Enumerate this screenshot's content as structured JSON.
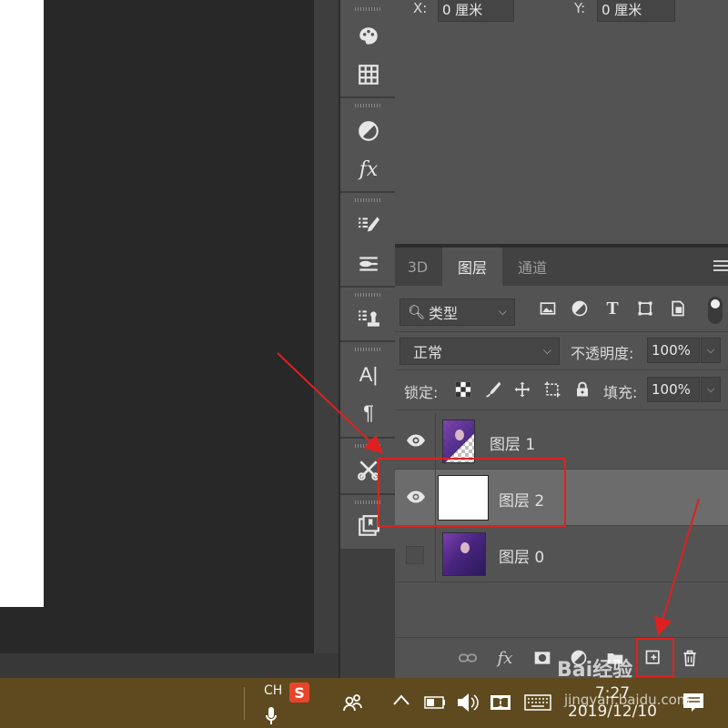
{
  "properties": {
    "x_label": "X:",
    "x_value": "0 厘米",
    "y_label": "Y:",
    "y_value": "0 厘米"
  },
  "layers_panel": {
    "tabs": [
      {
        "label": "3D",
        "active": false
      },
      {
        "label": "图层",
        "active": true
      },
      {
        "label": "通道",
        "active": false
      }
    ],
    "filter_type": "类型",
    "blend_mode": "正常",
    "opacity_label": "不透明度:",
    "opacity_value": "100%",
    "lock_label": "锁定:",
    "fill_label": "填充:",
    "fill_value": "100%",
    "layers": [
      {
        "name": "图层 1",
        "visible": true,
        "selected": false,
        "thumbnail": "transparent-photo"
      },
      {
        "name": "图层 2",
        "visible": true,
        "selected": true,
        "thumbnail": "white"
      },
      {
        "name": "图层 0",
        "visible": false,
        "selected": false,
        "thumbnail": "photo"
      }
    ],
    "footer_icons": [
      "link-icon",
      "fx-icon",
      "mask-icon",
      "adjustment-icon",
      "group-folder-icon",
      "new-layer-icon",
      "trash-icon"
    ],
    "footer_fx": "fx"
  },
  "toolstrip": {
    "icons": [
      "palette-icon",
      "grid-icon",
      "adjust-icon",
      "fx-style-icon",
      "brush-settings-icon",
      "brush-presets-icon",
      "clone-source-icon",
      "character-icon",
      "paragraph-icon",
      "tools-icon",
      "paths-icon"
    ],
    "character_text": "A|",
    "paragraph_text": "¶",
    "fx_text": "fx"
  },
  "taskbar": {
    "ime": "CH",
    "ime_logo": "S",
    "time": "7:27",
    "date": "2019/12/10"
  },
  "watermark": {
    "brand": "Bai经验",
    "url": "jingyan.baidu.com"
  },
  "colors": {
    "annotation_red": "#e02020",
    "panel_bg": "#535353",
    "selected_layer": "#6c6c6c",
    "taskbar": "#5e4a1e"
  }
}
